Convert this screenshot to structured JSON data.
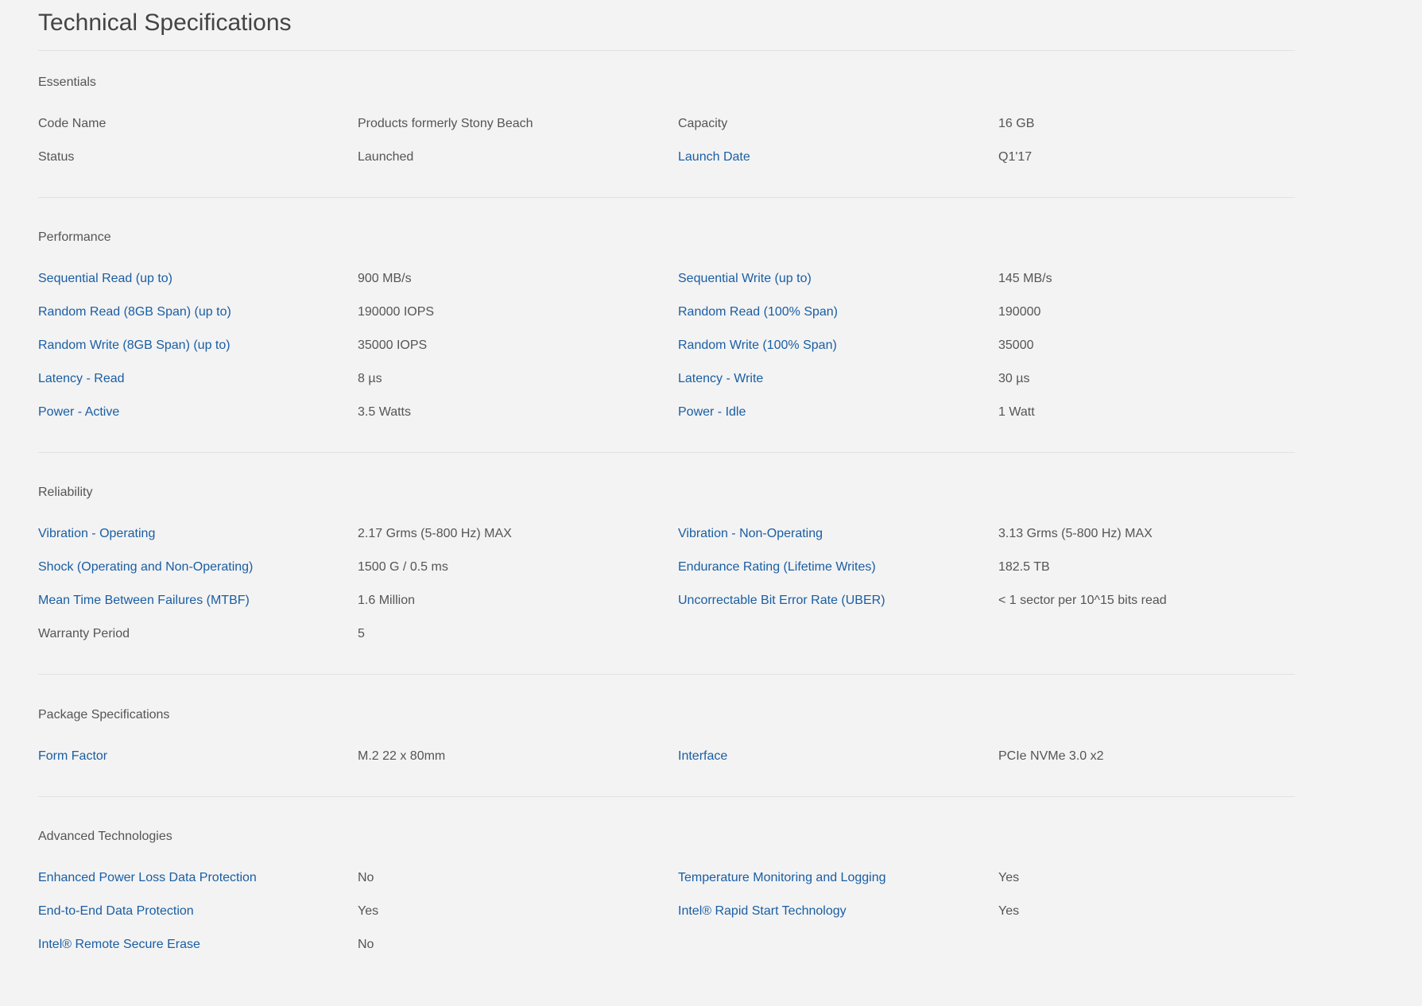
{
  "page_title": "Technical Specifications",
  "sections": [
    {
      "title": "Essentials",
      "rows": [
        {
          "left": {
            "label": "Code Name",
            "link": false,
            "value": "Products formerly Stony Beach"
          },
          "right": {
            "label": "Capacity",
            "link": false,
            "value": "16 GB"
          }
        },
        {
          "left": {
            "label": "Status",
            "link": false,
            "value": "Launched"
          },
          "right": {
            "label": "Launch Date",
            "link": true,
            "value": "Q1'17"
          }
        }
      ]
    },
    {
      "title": "Performance",
      "rows": [
        {
          "left": {
            "label": "Sequential Read (up to)",
            "link": true,
            "value": "900 MB/s"
          },
          "right": {
            "label": "Sequential Write (up to)",
            "link": true,
            "value": "145 MB/s"
          }
        },
        {
          "left": {
            "label": "Random Read (8GB Span) (up to)",
            "link": true,
            "value": "190000 IOPS"
          },
          "right": {
            "label": "Random Read (100% Span)",
            "link": true,
            "value": "190000"
          }
        },
        {
          "left": {
            "label": "Random Write (8GB Span) (up to)",
            "link": true,
            "value": "35000 IOPS"
          },
          "right": {
            "label": "Random Write (100% Span)",
            "link": true,
            "value": "35000"
          }
        },
        {
          "left": {
            "label": "Latency - Read",
            "link": true,
            "value": "8 µs"
          },
          "right": {
            "label": "Latency - Write",
            "link": true,
            "value": "30 µs"
          }
        },
        {
          "left": {
            "label": "Power - Active",
            "link": true,
            "value": "3.5 Watts"
          },
          "right": {
            "label": "Power - Idle",
            "link": true,
            "value": "1 Watt"
          }
        }
      ]
    },
    {
      "title": "Reliability",
      "rows": [
        {
          "left": {
            "label": "Vibration - Operating",
            "link": true,
            "value": "2.17 Grms (5-800 Hz) MAX"
          },
          "right": {
            "label": "Vibration - Non-Operating",
            "link": true,
            "value": "3.13 Grms (5-800 Hz) MAX"
          }
        },
        {
          "left": {
            "label": "Shock (Operating and Non-Operating)",
            "link": true,
            "value": "1500 G / 0.5 ms"
          },
          "right": {
            "label": "Endurance Rating (Lifetime Writes)",
            "link": true,
            "value": "182.5 TB"
          }
        },
        {
          "left": {
            "label": "Mean Time Between Failures (MTBF)",
            "link": true,
            "value": "1.6 Million"
          },
          "right": {
            "label": "Uncorrectable Bit Error Rate (UBER)",
            "link": true,
            "value": "< 1 sector per 10^15 bits read"
          }
        },
        {
          "left": {
            "label": "Warranty Period",
            "link": false,
            "value": "5"
          }
        }
      ]
    },
    {
      "title": "Package Specifications",
      "rows": [
        {
          "left": {
            "label": "Form Factor",
            "link": true,
            "value": "M.2 22 x 80mm"
          },
          "right": {
            "label": "Interface",
            "link": true,
            "value": "PCIe NVMe 3.0 x2"
          }
        }
      ]
    },
    {
      "title": "Advanced Technologies",
      "rows": [
        {
          "left": {
            "label": "Enhanced Power Loss Data Protection",
            "link": true,
            "value": "No"
          },
          "right": {
            "label": "Temperature Monitoring and Logging",
            "link": true,
            "value": "Yes"
          }
        },
        {
          "left": {
            "label": "End-to-End Data Protection",
            "link": true,
            "value": "Yes"
          },
          "right": {
            "label": "Intel® Rapid Start Technology",
            "link": true,
            "value": "Yes"
          }
        },
        {
          "left": {
            "label": "Intel® Remote Secure Erase",
            "link": true,
            "value": "No"
          }
        }
      ]
    }
  ],
  "colors": {
    "background": "#f3f3f3",
    "link": "#1a5ea3",
    "text": "#555555",
    "title": "#444444",
    "divider": "#e1e1e1"
  }
}
